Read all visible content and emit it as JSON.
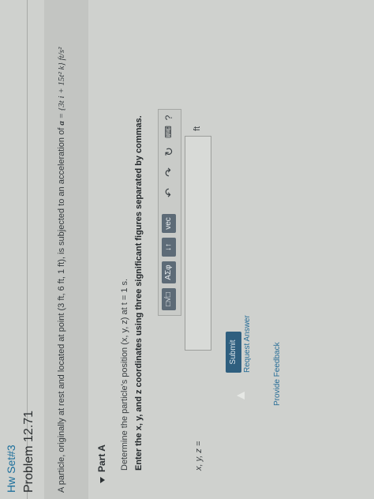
{
  "header": {
    "hw_set": "Hw Set#3",
    "problem_title": "Problem 12.71"
  },
  "statement": {
    "text": "A particle, originally at rest and located at point (3 ft, 6 ft, 1 ft), is subjected to an acceleration of ",
    "a_symbol": "a",
    "equation": " = {3t i + 15t² k} ft/s²"
  },
  "part": {
    "label": "Part A"
  },
  "question": {
    "text": "Determine the particle's position (x, y, z) at t = 1 s."
  },
  "instruction": {
    "text": "Enter the x, y, and z coordinates using three significant figures separated by commas."
  },
  "toolbar": {
    "templates": "□√□",
    "greek": "ΑΣφ",
    "arrows": "↓↑",
    "vec": "vec",
    "undo": "↶",
    "redo": "↷",
    "reset": "↻",
    "keyboard": "⌨",
    "help": "?"
  },
  "answer": {
    "label": "x, y, z =",
    "value": "",
    "unit": "ft"
  },
  "buttons": {
    "submit": "Submit",
    "request_answer": "Request Answer"
  },
  "feedback": {
    "link": "Provide Feedback"
  }
}
